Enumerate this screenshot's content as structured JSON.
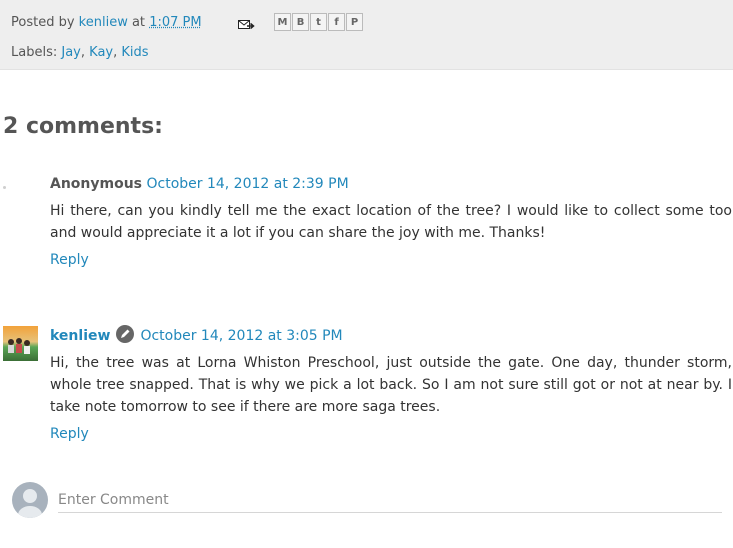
{
  "post_footer": {
    "posted_by_prefix": "Posted by",
    "author": "kenliew",
    "at_word": "at",
    "time": "1:07 PM",
    "labels_prefix": "Labels:",
    "labels": [
      "Jay",
      "Kay",
      "Kids"
    ],
    "share_buttons": [
      {
        "name": "email-this-icon",
        "glyph": "M"
      },
      {
        "name": "blogthis-icon",
        "glyph": "B"
      },
      {
        "name": "twitter-share-icon",
        "glyph": "t"
      },
      {
        "name": "facebook-share-icon",
        "glyph": "f"
      },
      {
        "name": "pinterest-share-icon",
        "glyph": "P"
      }
    ]
  },
  "comments_heading": "2 comments:",
  "comments": [
    {
      "author": "Anonymous",
      "timestamp": "October 14, 2012 at 2:39 PM",
      "body": "Hi there, can you kindly tell me the exact location of the tree? I would like to collect some too and would appreciate it a lot if you can share the joy with me. Thanks!",
      "reply_label": "Reply"
    },
    {
      "author": "kenliew",
      "timestamp": "October 14, 2012 at 3:05 PM",
      "body": "Hi, the tree was at Lorna Whiston Preschool, just outside the gate. One day, thunder storm, whole tree snapped. That is why we pick a lot back. So I am not sure still got or not at near by. I take note tomorrow to see if there are more saga trees.",
      "reply_label": "Reply"
    }
  ],
  "new_comment": {
    "placeholder": "Enter Comment"
  },
  "colors": {
    "link": "#2288bb",
    "footer_bg": "#eeeeee"
  }
}
